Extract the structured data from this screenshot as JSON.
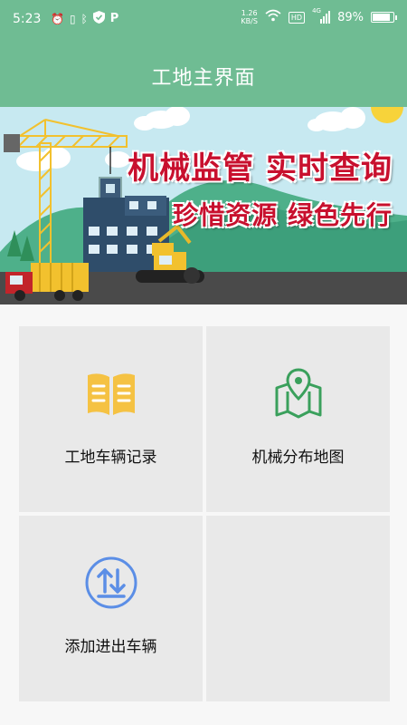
{
  "status_bar": {
    "time": "5:23",
    "net_speed_value": "1.26",
    "net_speed_unit": "KB/S",
    "hd_label": "HD",
    "signal_label": "4G",
    "battery_percent": "89%",
    "battery_level": 0.89,
    "icons": [
      "alarm-icon",
      "vibrate-icon",
      "bluetooth-icon",
      "shield-icon",
      "p-app-icon",
      "wifi-icon",
      "signal-icon",
      "battery-icon"
    ]
  },
  "header": {
    "title": "工地主界面"
  },
  "banner": {
    "slogan_line1": "机械监管  实时查询",
    "slogan_line2": "珍惜资源  绿色先行",
    "colors": {
      "sky": "#bfe6ef",
      "hill": "#4eb08a",
      "road": "#4a4a4a",
      "slogan": "#c8102e"
    }
  },
  "menu": {
    "items": [
      {
        "label": "工地车辆记录",
        "icon": "open-book-icon",
        "icon_color": "#f5c243"
      },
      {
        "label": "机械分布地图",
        "icon": "map-pin-icon",
        "icon_color": "#3aa05c"
      },
      {
        "label": "添加进出车辆",
        "icon": "up-down-arrows-icon",
        "icon_color": "#5b8ee6"
      },
      {
        "label": "",
        "icon": "",
        "icon_color": ""
      }
    ]
  },
  "colors": {
    "accent": "#6fbc93",
    "tile_bg": "#e9e9e9",
    "page_bg": "#f7f7f7"
  }
}
